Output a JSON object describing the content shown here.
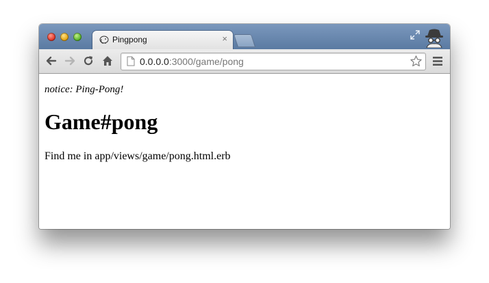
{
  "window": {
    "controls": [
      "close",
      "minimize",
      "maximize"
    ]
  },
  "tabs": [
    {
      "title": "Pingpong",
      "icon": "elephant-favicon-icon",
      "active": true,
      "close_label": "×"
    }
  ],
  "toolbar": {
    "back_icon": "back-arrow-icon",
    "forward_icon": "forward-arrow-icon",
    "reload_icon": "reload-icon",
    "home_icon": "home-icon",
    "menu_icon": "hamburger-menu-icon",
    "bookmark_icon": "star-icon"
  },
  "address_bar": {
    "host": "0.0.0.0",
    "rest": ":3000/game/pong"
  },
  "page": {
    "notice": "notice: Ping-Pong!",
    "heading": "Game#pong",
    "body": "Find me in app/views/game/pong.html.erb"
  },
  "colors": {
    "titlebar": "#6a89b0",
    "toolbar": "#e2e2e2",
    "url_host": "#222222",
    "url_path": "#777777"
  }
}
